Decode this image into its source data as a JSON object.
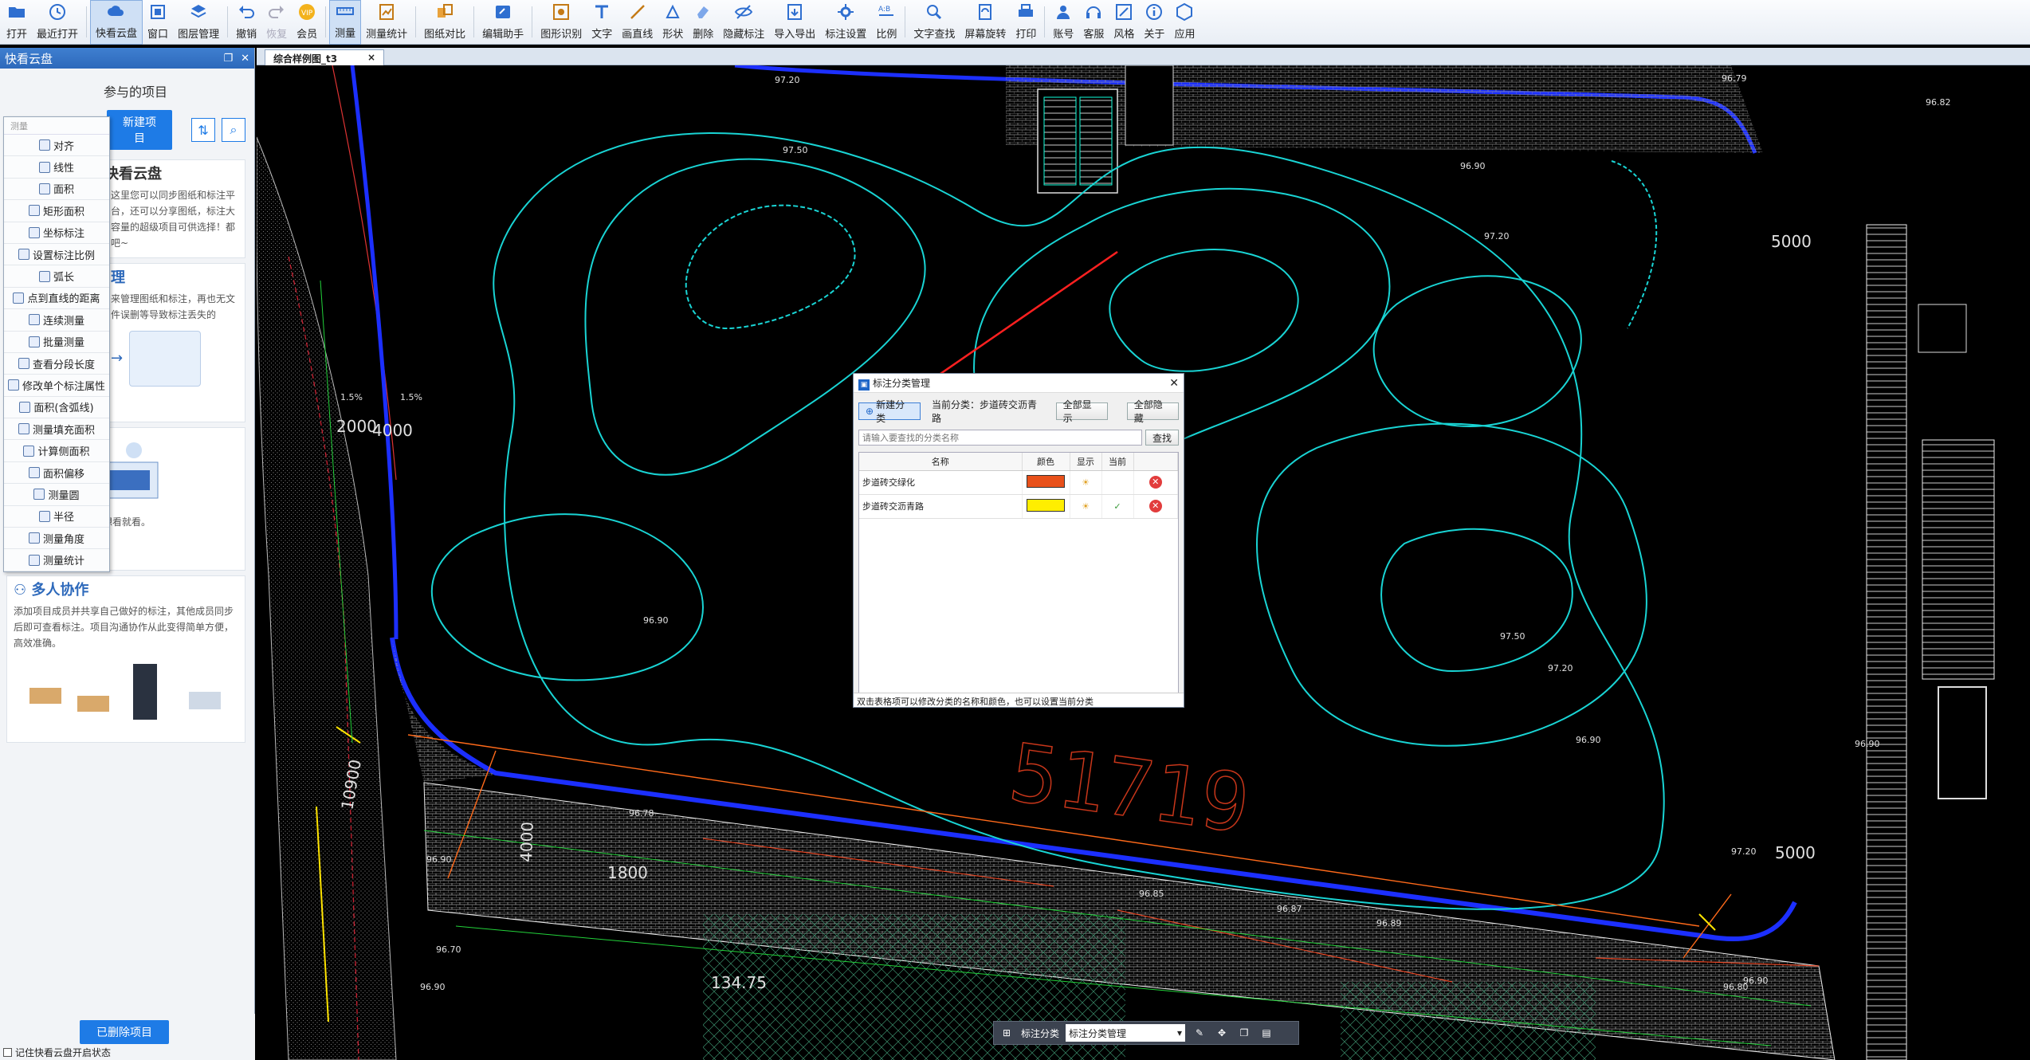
{
  "toolbar": {
    "items": [
      {
        "label": "打开",
        "icon": "folder-open-icon"
      },
      {
        "label": "最近打开",
        "icon": "clock-icon"
      },
      {
        "label": "快看云盘",
        "icon": "cloud-icon",
        "active": true
      },
      {
        "label": "窗口",
        "icon": "window-icon"
      },
      {
        "label": "图层管理",
        "icon": "layers-icon"
      },
      {
        "label": "撤销",
        "icon": "undo-icon"
      },
      {
        "label": "恢复",
        "icon": "redo-icon",
        "dim": true
      },
      {
        "label": "会员",
        "icon": "vip-icon"
      },
      {
        "label": "测量",
        "icon": "measure-icon",
        "active": true
      },
      {
        "label": "测量统计",
        "icon": "measure-stats-icon"
      },
      {
        "label": "图纸对比",
        "icon": "compare-icon"
      },
      {
        "label": "编辑助手",
        "icon": "edit-assistant-icon"
      },
      {
        "label": "图形识别",
        "icon": "shape-recognize-icon"
      },
      {
        "label": "文字",
        "icon": "text-icon"
      },
      {
        "label": "画直线",
        "icon": "line-icon"
      },
      {
        "label": "形状",
        "icon": "shape-icon"
      },
      {
        "label": "删除",
        "icon": "eraser-icon"
      },
      {
        "label": "隐藏标注",
        "icon": "hide-annotation-icon"
      },
      {
        "label": "导入导出",
        "icon": "import-export-icon"
      },
      {
        "label": "标注设置",
        "icon": "annotation-settings-icon"
      },
      {
        "label": "比例",
        "icon": "scale-icon"
      },
      {
        "label": "文字查找",
        "icon": "text-search-icon"
      },
      {
        "label": "屏幕旋转",
        "icon": "rotate-screen-icon"
      },
      {
        "label": "打印",
        "icon": "print-icon"
      },
      {
        "label": "账号",
        "icon": "account-icon"
      },
      {
        "label": "客服",
        "icon": "headset-icon"
      },
      {
        "label": "风格",
        "icon": "style-icon"
      },
      {
        "label": "关于",
        "icon": "info-icon"
      },
      {
        "label": "应用",
        "icon": "apps-icon"
      }
    ]
  },
  "left_panel": {
    "title": "快看云盘",
    "projects_label": "参与的项目",
    "new_project": "新建项目",
    "heading": "快看云盘",
    "intro": "这里您可以同步图纸和标注平台，还可以分享图纸，标注大容量的超级项目可供选择！都吧~",
    "section2_title": "理",
    "section2_text": "来管理图纸和标注，再也无文件误删等导致标注丢失的",
    "section3_text": "注共享，随时随地，想看就看。",
    "collab_title": "多人协作",
    "collab_text": "添加项目成员并共享自己做好的标注，其他成员同步后即可查看标注。项目沟通协作从此变得简单方便，高效准确。",
    "deleted_projects": "已删除项目",
    "autostart": "记住快看云盘开启状态"
  },
  "measure_menu": {
    "header": "测量",
    "items": [
      "对齐",
      "线性",
      "面积",
      "矩形面积",
      "坐标标注",
      "设置标注比例",
      "弧长",
      "点到直线的距离",
      "连续测量",
      "批量测量",
      "查看分段长度",
      "修改单个标注属性",
      "面积(含弧线)",
      "测量填充面积",
      "计算侧面积",
      "面积偏移",
      "测量圆",
      "半径",
      "测量角度",
      "测量统计"
    ]
  },
  "tab": {
    "label": "综合样例图_t3",
    "close": "×"
  },
  "dialog": {
    "title": "标注分类管理",
    "new_category": "新建分类",
    "current_label": "当前分类：步道砖交沥青路",
    "show_all": "全部显示",
    "hide_all": "全部隐藏",
    "search_placeholder": "请输入要查找的分类名称",
    "search_btn": "查找",
    "columns": [
      "名称",
      "颜色",
      "显示",
      "当前",
      ""
    ],
    "rows": [
      {
        "name": "步道砖交绿化",
        "color": "#e8501a",
        "current": false
      },
      {
        "name": "步道砖交沥青路",
        "color": "#ffee00",
        "current": true
      }
    ],
    "footer": "双击表格项可以修改分类的名称和颜色，也可以设置当前分类"
  },
  "floatbar": {
    "label": "标注分类",
    "select": "标注分类管理"
  },
  "drawing": {
    "labels": [
      {
        "t": "97.20"
      },
      {
        "t": "97.50"
      },
      {
        "t": "96.90"
      },
      {
        "t": "97.20"
      },
      {
        "t": "97.50"
      },
      {
        "t": "97.20"
      },
      {
        "t": "96.90"
      },
      {
        "t": "96.90"
      },
      {
        "t": "96.90"
      },
      {
        "t": "97.20"
      },
      {
        "t": "96.90"
      },
      {
        "t": "96.90"
      },
      {
        "t": "2000"
      },
      {
        "t": "4000"
      },
      {
        "t": "1.5%"
      },
      {
        "t": "1.5%"
      },
      {
        "t": "5000"
      },
      {
        "t": "5000"
      },
      {
        "t": "4000"
      },
      {
        "t": "1800"
      },
      {
        "t": "134.75"
      },
      {
        "t": "10900"
      },
      {
        "t": "51719"
      },
      {
        "t": "96.79"
      },
      {
        "t": "96.82"
      },
      {
        "t": "96.78"
      },
      {
        "t": "96.85"
      },
      {
        "t": "96.87"
      },
      {
        "t": "96.89"
      },
      {
        "t": "96.80"
      },
      {
        "t": "96.90"
      },
      {
        "t": "96.70"
      }
    ]
  }
}
